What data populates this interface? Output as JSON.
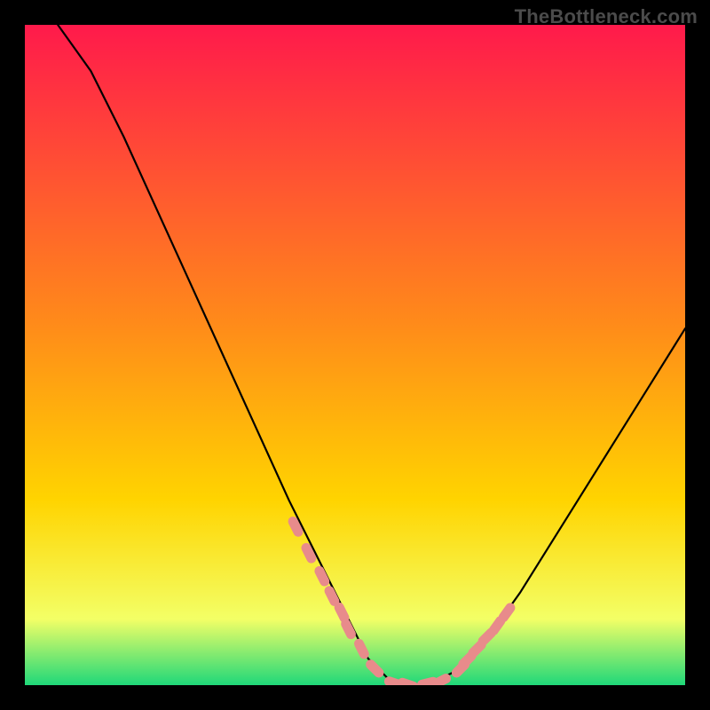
{
  "watermark": "TheBottleneck.com",
  "chart_data": {
    "type": "line",
    "title": "",
    "xlabel": "",
    "ylabel": "",
    "xlim": [
      0,
      100
    ],
    "ylim": [
      0,
      100
    ],
    "grid": false,
    "legend": false,
    "background_gradient": {
      "top_color": "#ff1a4b",
      "mid_color": "#ffd400",
      "near_bottom_color": "#f3ff66",
      "bottom_color": "#1fd879"
    },
    "series": [
      {
        "name": "bottleneck-curve",
        "color": "#000000",
        "x": [
          5,
          10,
          15,
          20,
          25,
          30,
          35,
          40,
          45,
          50,
          52,
          55,
          58,
          60,
          62,
          65,
          70,
          75,
          80,
          85,
          90,
          95,
          100
        ],
        "y": [
          100,
          93,
          83,
          72,
          61,
          50,
          39,
          28,
          18,
          8,
          4,
          1,
          0,
          0,
          0.5,
          2,
          7,
          14,
          22,
          30,
          38,
          46,
          54
        ]
      }
    ],
    "markers": {
      "name": "highlight-points",
      "color": "#e88b8b",
      "shape": "capsule",
      "x": [
        41,
        43,
        45,
        46.5,
        48,
        49,
        51,
        53,
        56,
        58,
        61,
        63,
        66,
        67,
        68.5,
        70,
        71.5,
        73
      ],
      "y": [
        24,
        20,
        16.5,
        13.5,
        11,
        8.5,
        5.5,
        2.5,
        0.3,
        0.1,
        0.3,
        0.6,
        2.5,
        3.8,
        5.5,
        7.3,
        9,
        11
      ]
    }
  }
}
